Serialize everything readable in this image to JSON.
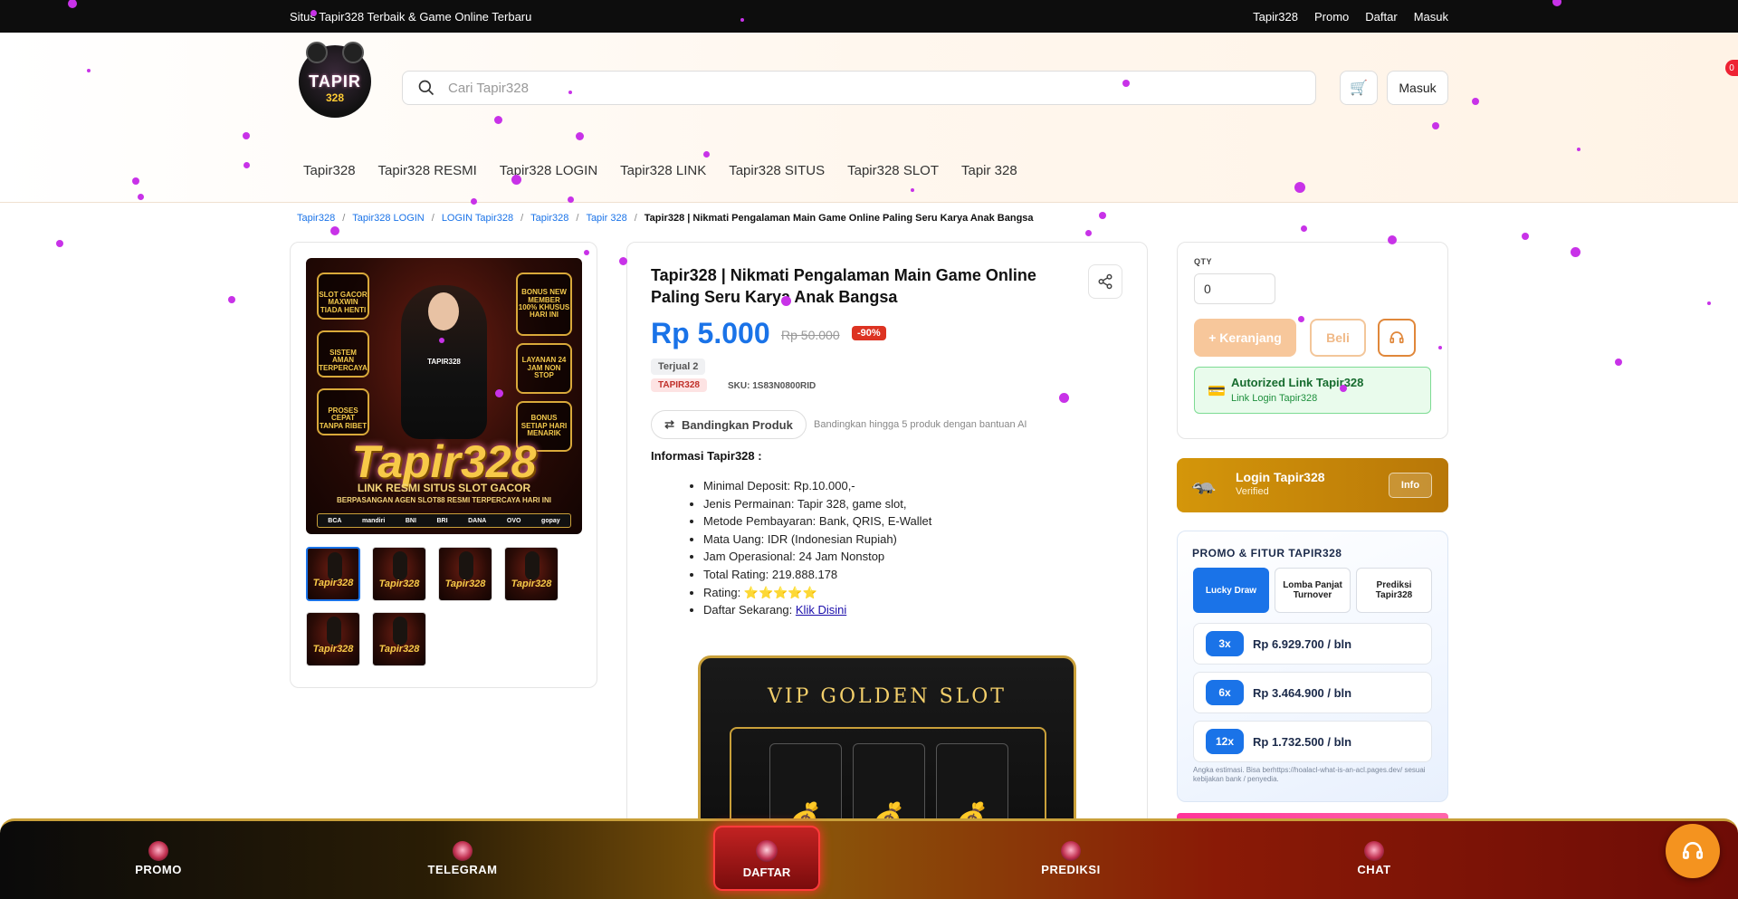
{
  "topbar": {
    "tagline": "Situs Tapir328 Terbaik & Game Online Terbaru",
    "links": [
      "Tapir328",
      "Promo",
      "Daftar",
      "Masuk"
    ]
  },
  "header": {
    "logo_text": "TAPIR",
    "logo_sub": "328",
    "search_placeholder": "Cari Tapir328",
    "cart_icon": "cart-icon",
    "login_label": "Masuk",
    "cart_count": "0"
  },
  "nav": [
    "Tapir328",
    "Tapir328 RESMI",
    "Tapir328 LOGIN",
    "Tapir328 LINK",
    "Tapir328 SITUS",
    "Tapir328 SLOT",
    "Tapir 328"
  ],
  "breadcrumb": {
    "items": [
      "Tapir328",
      "Tapir328 LOGIN",
      "LOGIN Tapir328",
      "Tapir328",
      "Tapir 328"
    ],
    "current": "Tapir328 | Nikmati Pengalaman Main Game Online Paling Seru Karya Anak Bangsa"
  },
  "gallery": {
    "brand": "Tapir328",
    "sub1": "LINK RESMI SITUS SLOT GACOR",
    "sub2": "BERPASANGAN AGEN SLOT88 RESMI TERPERCAYA HARI INI",
    "shirt": "TAPIR328",
    "badges_left": [
      "SLOT GACOR MAXWIN TIADA HENTI",
      "SISTEM AMAN TERPERCAYA",
      "PROSES CEPAT TANPA RIBET"
    ],
    "badges_right": [
      "BONUS NEW MEMBER 100% KHUSUS HARI INI",
      "LAYANAN 24 JAM NON STOP",
      "BONUS SETIAP HARI MENARIK"
    ],
    "banks": [
      "BCA",
      "mandiri",
      "BNI",
      "BRI",
      "DANA",
      "OVO",
      "gopay"
    ],
    "thumb_label": "Tapir328",
    "thumb_count": 6
  },
  "product": {
    "title": "Tapir328 | Nikmati Pengalaman Main Game Online Paling Seru Karya Anak Bangsa",
    "price": "Rp 5.000",
    "old_price": "Rp 50.000",
    "discount": "-90%",
    "sold": "Terjual 2",
    "tag": "TAPIR328",
    "sku": "SKU: 1S83N0800RID",
    "compare_label": "Bandingkan Produk",
    "compare_hint": "Bandingkan hingga 5 produk dengan bantuan AI",
    "info_heading": "Informasi Tapir328 :",
    "details": [
      "Minimal Deposit: Rp.10.000,-",
      "Jenis Permainan: Tapir 328, game slot,",
      "Metode Pembayaran: Bank, QRIS, E-Wallet",
      "Mata Uang: IDR (Indonesian Rupiah)",
      "Jam Operasional: 24 Jam Nonstop",
      "Total Rating: 219.888.178",
      "Rating: ⭐⭐⭐⭐⭐"
    ],
    "register_prefix": "Daftar Sekarang: ",
    "register_link": "Klik Disini"
  },
  "slot": {
    "title": "VIP GOLDEN SLOT",
    "reels": [
      "💰",
      "💰",
      "💰"
    ]
  },
  "buybox": {
    "qty_label": "QTY",
    "qty_value": "0",
    "cart_label": "+ Keranjang",
    "buy_label": "Beli",
    "auth_title": "Autorized Link Tapir328",
    "auth_sub": "Link Login Tapir328",
    "auth_icon": "💳"
  },
  "login_card": {
    "title": "Login Tapir328",
    "sub": "Verified",
    "info": "Info"
  },
  "promo": {
    "heading": "PROMO & FITUR TAPIR328",
    "tabs": [
      "Lucky Draw",
      "Lomba Panjat Turnover",
      "Prediksi Tapir328"
    ],
    "rows": [
      {
        "term": "3x",
        "amount": "Rp 6.929.700 / bln"
      },
      {
        "term": "6x",
        "amount": "Rp 3.464.900 / bln"
      },
      {
        "term": "12x",
        "amount": "Rp 1.732.500 / bln"
      }
    ],
    "note": "Angka estimasi. Bisa berhttps://hoalacl-what-is-an-acl.pages.dev/ sesuai kebijakan bank / penyedia."
  },
  "bottom_nav": {
    "items": [
      "PROMO",
      "TELEGRAM",
      "DAFTAR",
      "PREDIKSI",
      "CHAT"
    ]
  },
  "colors": {
    "accent": "#1a73e8",
    "gold": "#c9a03a",
    "discount_red": "#d32f2f",
    "sparkle": "#c832e8"
  }
}
